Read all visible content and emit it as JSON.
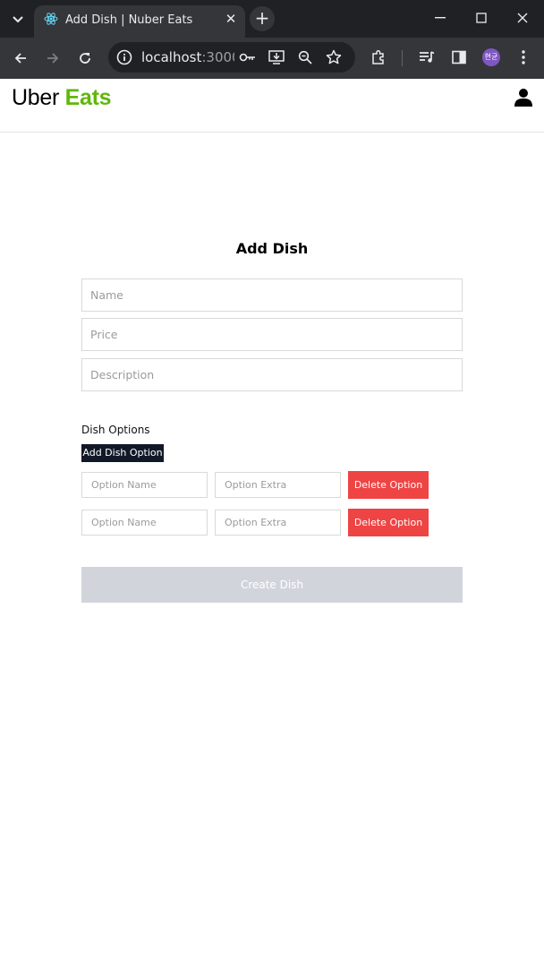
{
  "browser": {
    "tab_title": "Add Dish | Nuber Eats",
    "url_host": "localhost",
    "url_rest": ":3000...",
    "profile_initials": "현균",
    "icons": [
      "tab-list-icon",
      "react-favicon-icon",
      "close-icon",
      "new-tab-icon",
      "minimize-icon",
      "maximize-icon",
      "window-close-icon",
      "back-icon",
      "forward-icon",
      "reload-icon",
      "site-info-icon",
      "password-key-icon",
      "install-app-icon",
      "zoom-icon",
      "bookmark-star-icon",
      "extensions-icon",
      "media-control-icon",
      "side-panel-icon",
      "kebab-menu-icon"
    ]
  },
  "header": {
    "logo_uber": "Uber",
    "logo_eats": "Eats",
    "logo_green": "#5fb709",
    "user_icon": "user-icon"
  },
  "form": {
    "title": "Add Dish",
    "name_placeholder": "Name",
    "price_placeholder": "Price",
    "description_placeholder": "Description",
    "options_label": "Dish Options",
    "add_option_label": "Add Dish Option",
    "options": [
      {
        "name_placeholder": "Option Name",
        "extra_placeholder": "Option Extra",
        "delete_label": "Delete Option"
      },
      {
        "name_placeholder": "Option Name",
        "extra_placeholder": "Option Extra",
        "delete_label": "Delete Option"
      }
    ],
    "submit_label": "Create Dish",
    "submit_state": "disabled"
  },
  "colors": {
    "delete": "#ef4444",
    "add_option_bg": "#111827",
    "submit_disabled": "#d1d5db"
  }
}
